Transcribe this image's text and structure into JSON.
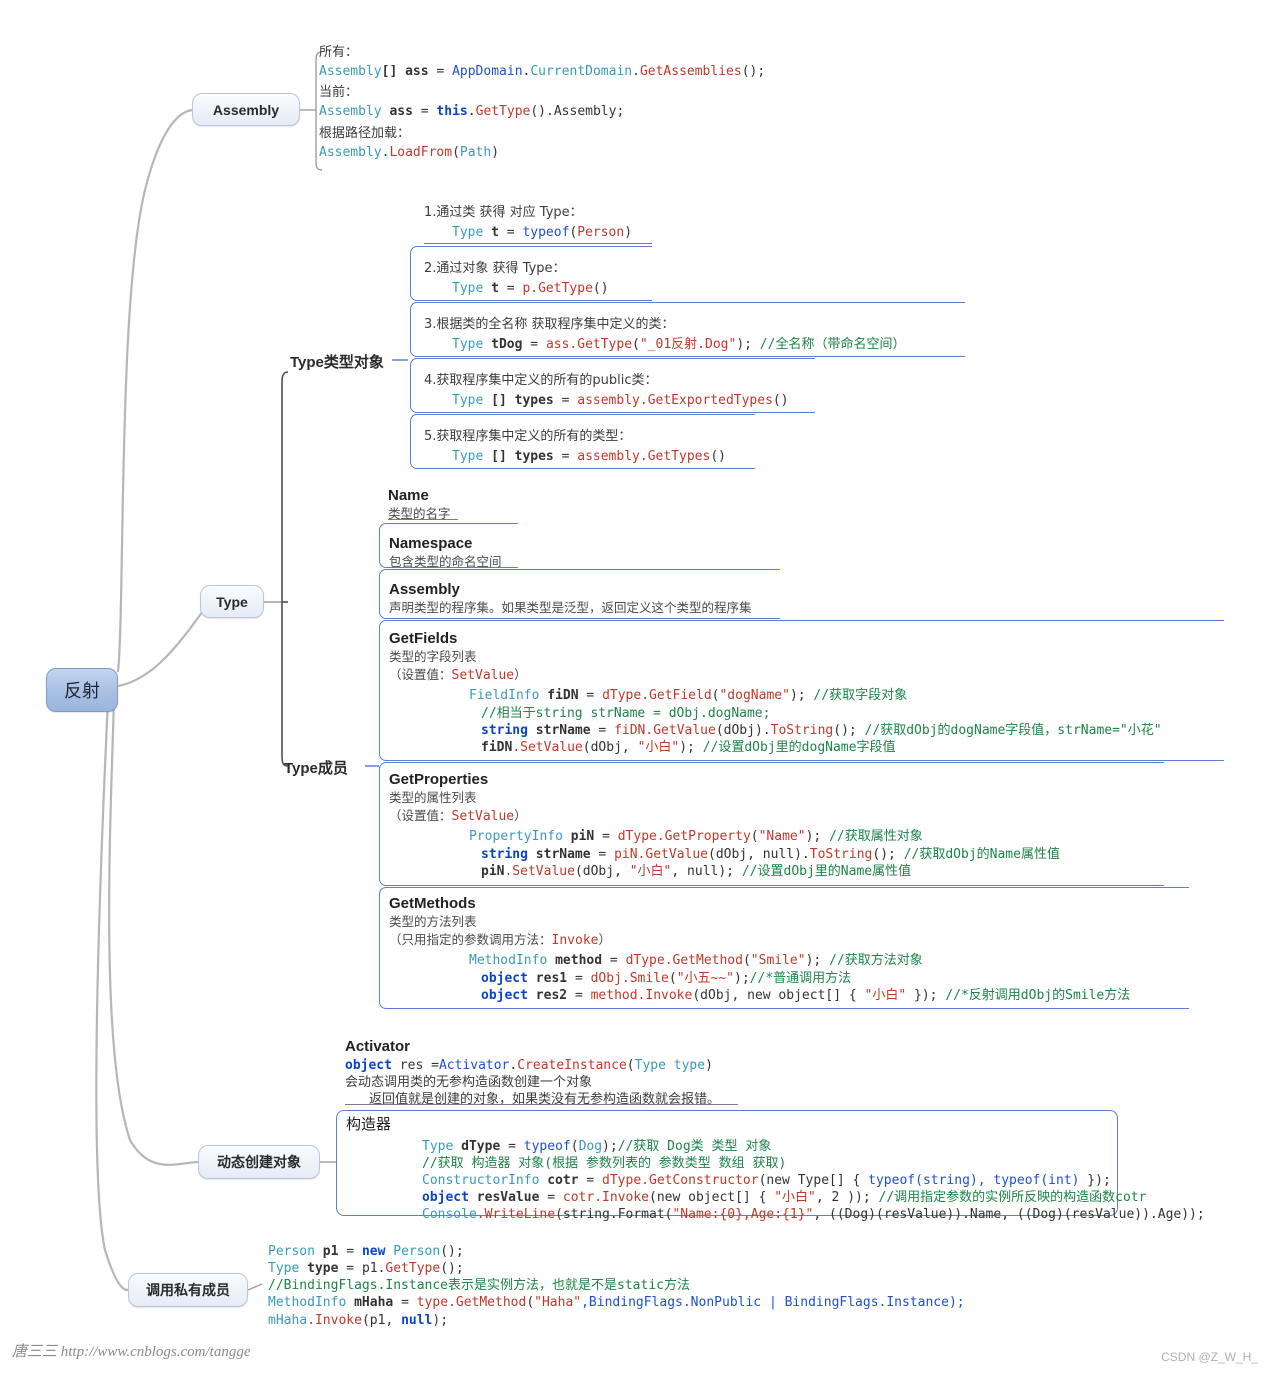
{
  "root": {
    "label": "反射"
  },
  "nodes": {
    "assembly": "Assembly",
    "type": "Type",
    "dynamic_create": "动态创建对象",
    "private_member": "调用私有成员"
  },
  "branch_labels": {
    "type_object": "Type类型对象",
    "type_members": "Type成员"
  },
  "assembly_block": {
    "l1": "所有：",
    "l2_pre": "Assembly",
    "l2_b": "[] ",
    "l2_var": "ass",
    "l2_eq": " = ",
    "l2_a": "AppDomain",
    "l2_dot1": ".",
    "l2_b2": "CurrentDomain",
    "l2_dot2": ".",
    "l2_m": "GetAssemblies",
    "l2_end": "();",
    "l3": "当前：",
    "l4_pre": "Assembly",
    "l4_var": " ass",
    "l4_eq": " = ",
    "l4_this": "this",
    "l4_dot": ".",
    "l4_m": "GetType",
    "l4_end": "().Assembly;",
    "l5": "根据路径加载：",
    "l6_a": "Assembly",
    "l6_dot": ".",
    "l6_m": "LoadFrom",
    "l6_p1": "(",
    "l6_arg": "Path",
    "l6_p2": ")"
  },
  "type_object_items": [
    {
      "title": "1.通过类 获得 对应 Type：",
      "code_ty": "Type",
      "code_var": " t ",
      "code_eq": "= ",
      "code_m": "typeof",
      "code_p1": "(",
      "code_arg": "Person",
      "code_p2": ")",
      "comment": ""
    },
    {
      "title": "2.通过对象 获得 Type：",
      "code_ty": "Type",
      "code_var": " t ",
      "code_eq": "= ",
      "code_m": "p.GetType",
      "code_p1": "(",
      "code_arg": "",
      "code_p2": ")",
      "comment": ""
    },
    {
      "title": "3.根据类的全名称 获取程序集中定义的类：",
      "code_ty": "Type",
      "code_var": " tDog ",
      "code_eq": "= ",
      "code_m": "ass.GetType",
      "code_p1": "(",
      "code_arg": "\"_01反射.Dog\"",
      "code_p2": ");",
      "comment": " //全名称（带命名空间）"
    },
    {
      "title": "4.获取程序集中定义的所有的public类：",
      "code_ty": "Type",
      "code_var": " [] types ",
      "code_eq": "= ",
      "code_m": "assembly.GetExportedTypes",
      "code_p1": "(",
      "code_arg": "",
      "code_p2": ")",
      "comment": ""
    },
    {
      "title": "5.获取程序集中定义的所有的类型：",
      "code_ty": "Type",
      "code_var": " [] types ",
      "code_eq": "= ",
      "code_m": "assembly.GetTypes",
      "code_p1": "(",
      "code_arg": "",
      "code_p2": ")",
      "comment": ""
    }
  ],
  "type_members": {
    "name": {
      "title": "Name",
      "desc": "类型的名字"
    },
    "namespace": {
      "title": "Namespace",
      "desc": "包含类型的命名空间"
    },
    "assembly": {
      "title": "Assembly",
      "desc": "声明类型的程序集。如果类型是泛型，返回定义这个类型的程序集"
    },
    "getfields": {
      "title": "GetFields",
      "desc": "类型的字段列表",
      "note_pre": "（设置值：",
      "note_code": "SetValue",
      "note_post": "）",
      "lines": [
        {
          "a": "FieldInfo",
          "b": " fiDN ",
          "c": "= ",
          "d": "dType.GetField",
          "e": "(",
          "f": "\"dogName\"",
          "g": "); ",
          "h": "//获取字段对象"
        },
        {
          "a": "",
          "b": "",
          "c": "",
          "d": "",
          "e": "",
          "f": "",
          "g": "",
          "h": "//相当于string strName = dObj.dogName;"
        },
        {
          "a": "string",
          "b": " strName ",
          "c": "= ",
          "d": "fiDN.GetValue",
          "e": "(dObj).",
          "f": "ToString",
          "g": "(); ",
          "h": "//获取dObj的dogName字段值，strName=\"小花\""
        },
        {
          "a": "",
          "b": "fiDN",
          "c": ".SetValue",
          "d": "(dObj, ",
          "e": "\"小白\"",
          "f": "); ",
          "g": "",
          "h": "//设置dObj里的dogName字段值"
        }
      ]
    },
    "getproperties": {
      "title": "GetProperties",
      "desc": "类型的属性列表",
      "note_pre": "（设置值：",
      "note_code": "SetValue",
      "note_post": "）",
      "lines": [
        {
          "a": "PropertyInfo",
          "b": " piN ",
          "c": "= ",
          "d": "dType.GetProperty",
          "e": "(",
          "f": "\"Name\"",
          "g": "); ",
          "h": "//获取属性对象"
        },
        {
          "a": "string",
          "b": " strName ",
          "c": "= ",
          "d": "piN.GetValue",
          "e": "(dObj, null).",
          "f": "ToString",
          "g": "(); ",
          "h": "//获取dObj的Name属性值"
        },
        {
          "a": "",
          "b": "piN",
          "c": ".SetValue",
          "d": "(dObj, ",
          "e": "\"小白\"",
          "f": ", null); ",
          "g": "",
          "h": "//设置dObj里的Name属性值"
        }
      ]
    },
    "getmethods": {
      "title": "GetMethods",
      "desc": "类型的方法列表",
      "note_pre": "（只用指定的参数调用方法：",
      "note_code": "Invoke",
      "note_post": "）",
      "lines": [
        {
          "a": "MethodInfo",
          "b": " method ",
          "c": "= ",
          "d": "dType.GetMethod",
          "e": "(",
          "f": "\"Smile\"",
          "g": "); ",
          "h": "//获取方法对象"
        },
        {
          "a": "object",
          "b": " res1 ",
          "c": "= ",
          "d": "dObj.Smile",
          "e": "(",
          "f": "\"小五~~\"",
          "g": ");",
          "h": "//*普通调用方法"
        },
        {
          "a": "object",
          "b": " res2 ",
          "c": "= ",
          "d": "method.Invoke",
          "e": "(dObj, new object[] { ",
          "f": "\"小白\"",
          "g": " }); ",
          "h": "//*反射调用dObj的Smile方法"
        }
      ]
    }
  },
  "activator": {
    "title": "Activator",
    "code_kw": "object",
    "code_var": " res =",
    "code_cls": "Activator",
    "code_dot": ".",
    "code_m": "CreateInstance",
    "code_p1": "(",
    "code_arg1": "Type",
    "code_arg2": " type",
    "code_p2": ")",
    "desc1": "会动态调用类的无参构造函数创建一个对象",
    "desc2": "返回值就是创建的对象，如果类没有无参构造函数就会报错。"
  },
  "constructor_box": {
    "title": "构造器",
    "lines": [
      {
        "a": "Type",
        "b": " dType ",
        "c": "= ",
        "d": "typeof",
        "e": "(",
        "f": "Dog",
        "g": ");",
        "h": "//获取 Dog类 类型 对象"
      },
      {
        "a": "",
        "b": "",
        "c": "",
        "d": "",
        "e": "",
        "f": "",
        "g": "",
        "h": "//获取 构造器 对象(根据 参数列表的 参数类型 数组 获取)"
      },
      {
        "a": "ConstructorInfo",
        "b": " cotr ",
        "c": "= ",
        "d": "dType.GetConstructor",
        "e": "(new Type[] { ",
        "f": "typeof(string), typeof(int)",
        "g": " });",
        "h": ""
      },
      {
        "a": "object",
        "b": " resValue ",
        "c": "= ",
        "d": "cotr.Invoke",
        "e": "(new object[] { ",
        "f": "\"小白\"",
        "g": ", 2 )); ",
        "h": "//调用指定参数的实例所反映的构造函数cotr"
      },
      {
        "a": "Console",
        "b": ".WriteLine",
        "c": "",
        "d": "(string.Format(",
        "e": "\"Name:{0},Age:{1}\"",
        "f": ", ((Dog)(resValue)).Name, ((Dog)(resValue)).Age));",
        "g": "",
        "h": ""
      }
    ]
  },
  "private_member_block": {
    "lines": [
      {
        "a": "Person",
        "b": " p1 ",
        "c": "= ",
        "d": "new ",
        "e": "Person",
        "f": "();",
        "g": "",
        "h": ""
      },
      {
        "a": "Type",
        "b": " type ",
        "c": "= ",
        "d": "p1.",
        "e": "GetType",
        "f": "();",
        "g": "",
        "h": ""
      },
      {
        "a": "",
        "b": "",
        "c": "",
        "d": "",
        "e": "",
        "f": "",
        "g": "",
        "h": "//BindingFlags.Instance表示是实例方法，也就是不是static方法"
      },
      {
        "a": "MethodInfo",
        "b": " mHaha ",
        "c": "= ",
        "d": "type.GetMethod",
        "e": "(",
        "f": "\"Haha\"",
        "g": ",BindingFlags.NonPublic | BindingFlags.Instance);",
        "h": ""
      },
      {
        "a": "mHaha",
        "b": ".Invoke",
        "c": "(p1, ",
        "d": "null",
        "e": ");",
        "f": "",
        "g": "",
        "h": ""
      }
    ]
  },
  "watermark": {
    "left_name": "唐三三",
    "left_url": "http://www.cnblogs.com/tangge",
    "right": "CSDN @Z_W_H_"
  },
  "colors": {
    "root_fill": "#a8c0e4",
    "node_fill": "#eef2f9",
    "branch_border": "#5b7fd6",
    "link_stroke": "#b6b6b6",
    "keyword": "#0b44c8",
    "type": "#3a9ab8",
    "method": "#c0392b",
    "comment": "#1e8449"
  }
}
